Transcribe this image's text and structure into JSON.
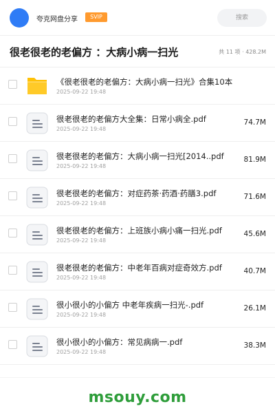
{
  "header": {
    "username": "夸克网盘分享",
    "badge": "SVIP",
    "search_placeholder": "搜索"
  },
  "page": {
    "title": "很老很老的老偏方 ：大病小病一扫光",
    "stats": "共 11 项 · 428.2M"
  },
  "files": [
    {
      "type": "folder",
      "name": "《很老很老的老偏方：大病小病一扫光》合集10本",
      "date": "2025-09-22 19:48",
      "size": ""
    },
    {
      "type": "pdf",
      "name": "很老很老的老偏方大全集：日常小病全.pdf",
      "date": "2025-09-22 19:48",
      "size": "74.7M"
    },
    {
      "type": "pdf",
      "name": "很老很老的老偏方：大病小病一扫光[2014..pdf",
      "date": "2025-09-22 19:48",
      "size": "81.9M"
    },
    {
      "type": "pdf",
      "name": "很老很老的老偏方：对症药茶·药酒·药膳3.pdf",
      "date": "2025-09-22 19:48",
      "size": "71.6M"
    },
    {
      "type": "pdf",
      "name": "很老很老的老偏方：上班族小病小痛一扫光.pdf",
      "date": "2025-09-22 19:48",
      "size": "45.6M"
    },
    {
      "type": "pdf",
      "name": "很老很老的老偏方：中老年百病对症奇效方.pdf",
      "date": "2025-09-22 19:48",
      "size": "40.7M"
    },
    {
      "type": "pdf",
      "name": "很小很小的小偏方 中老年疾病一扫光-.pdf",
      "date": "2025-09-22 19:48",
      "size": "26.1M"
    },
    {
      "type": "pdf",
      "name": "很小很小的小偏方：常见病病一.pdf",
      "date": "2025-09-22 19:48",
      "size": "38.3M"
    }
  ],
  "watermark": "msouy.com",
  "colors": {
    "accent": "#2f7cf6",
    "badge": "#ff9a2e",
    "folder": "#ffc107",
    "watermark": "#2e9d3a"
  }
}
